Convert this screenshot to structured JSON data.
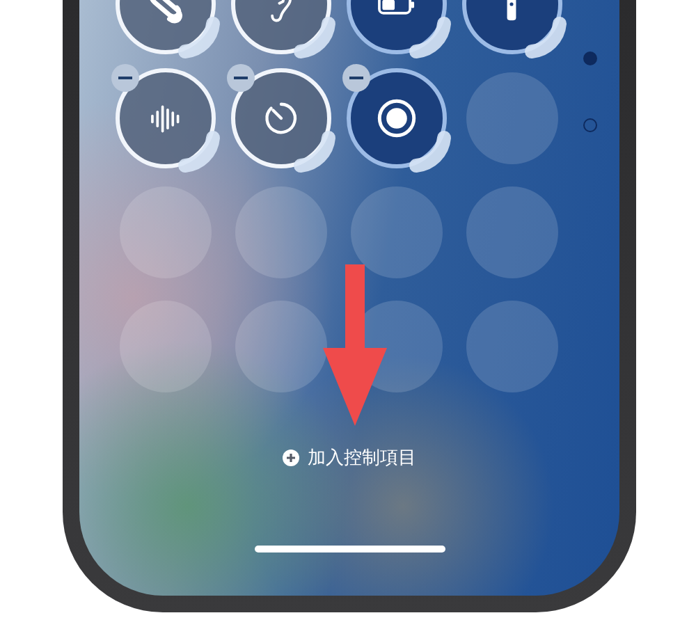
{
  "tiles": [
    {
      "kind": "shazam",
      "on": false
    },
    {
      "kind": "hearing",
      "on": false
    },
    {
      "kind": "battery",
      "on": true
    },
    {
      "kind": "flashlight",
      "on": true
    },
    {
      "kind": "voice",
      "on": false
    },
    {
      "kind": "timer",
      "on": false
    },
    {
      "kind": "record",
      "on": true
    },
    {
      "kind": "empty"
    },
    {
      "kind": "empty"
    },
    {
      "kind": "empty"
    },
    {
      "kind": "empty"
    },
    {
      "kind": "empty"
    },
    {
      "kind": "empty"
    },
    {
      "kind": "empty"
    },
    {
      "kind": "empty"
    },
    {
      "kind": "empty"
    }
  ],
  "page_dots": [
    {
      "selected": true
    },
    {
      "selected": false
    }
  ],
  "add_control": {
    "label": "加入控制項目"
  }
}
